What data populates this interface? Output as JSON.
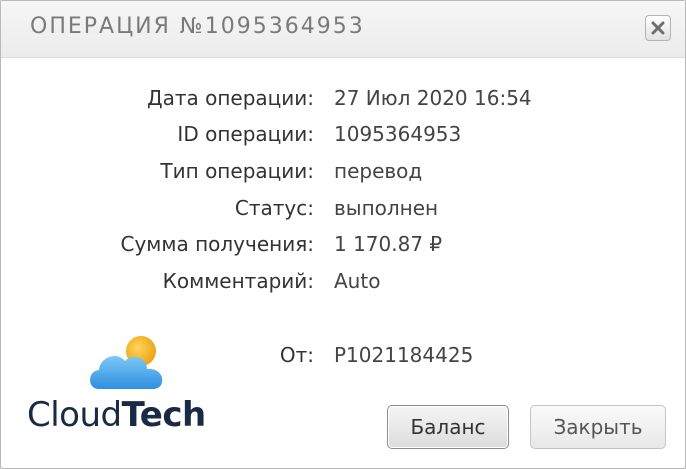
{
  "window": {
    "title": "ОПЕРАЦИЯ №1095364953",
    "close_icon": "close-icon"
  },
  "details": [
    {
      "label": "Дата операции:",
      "value": "27 Июл 2020 16:54"
    },
    {
      "label": "ID операции:",
      "value": "1095364953"
    },
    {
      "label": "Тип операции:",
      "value": "перевод"
    },
    {
      "label": "Статус:",
      "value": "выполнен"
    },
    {
      "label": "Сумма получения:",
      "value": "1 170.87 ₽"
    },
    {
      "label": "Комментарий:",
      "value": "Auto"
    }
  ],
  "from": {
    "label": "От:",
    "value": "P1021184425"
  },
  "logo": {
    "text_light": "Cloud",
    "text_bold": "Tech"
  },
  "buttons": {
    "balance": "Баланс",
    "close": "Закрыть"
  },
  "colors": {
    "title": "#7a7a7a",
    "text": "#333333",
    "logo_text": "#1a2a44",
    "cloud": "#3aa0e8",
    "sun": "#f2b21c"
  }
}
